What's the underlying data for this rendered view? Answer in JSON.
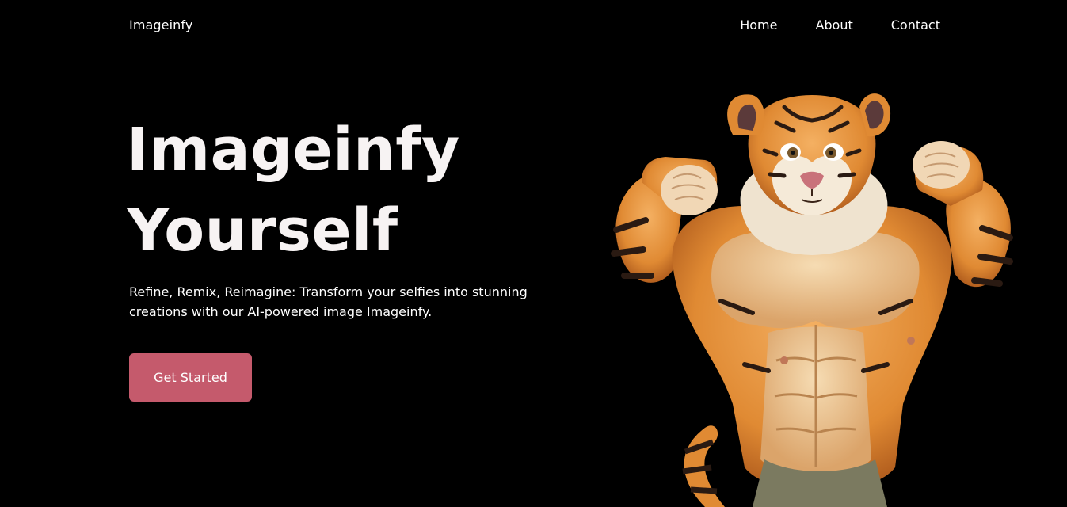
{
  "header": {
    "brand": "Imageinfy",
    "nav": [
      {
        "label": "Home"
      },
      {
        "label": "About"
      },
      {
        "label": "Contact"
      }
    ]
  },
  "hero": {
    "title_line1": "Imageinfy",
    "title_line2": "Yourself",
    "description": "Refine, Remix, Reimagine: Transform your selfies into stunning creations with our AI-powered image Imageinfy.",
    "cta_label": "Get Started",
    "illustration": "muscular-tiger-flexing"
  },
  "colors": {
    "background": "#000000",
    "text": "#ffffff",
    "accent": "#c55a6c"
  }
}
